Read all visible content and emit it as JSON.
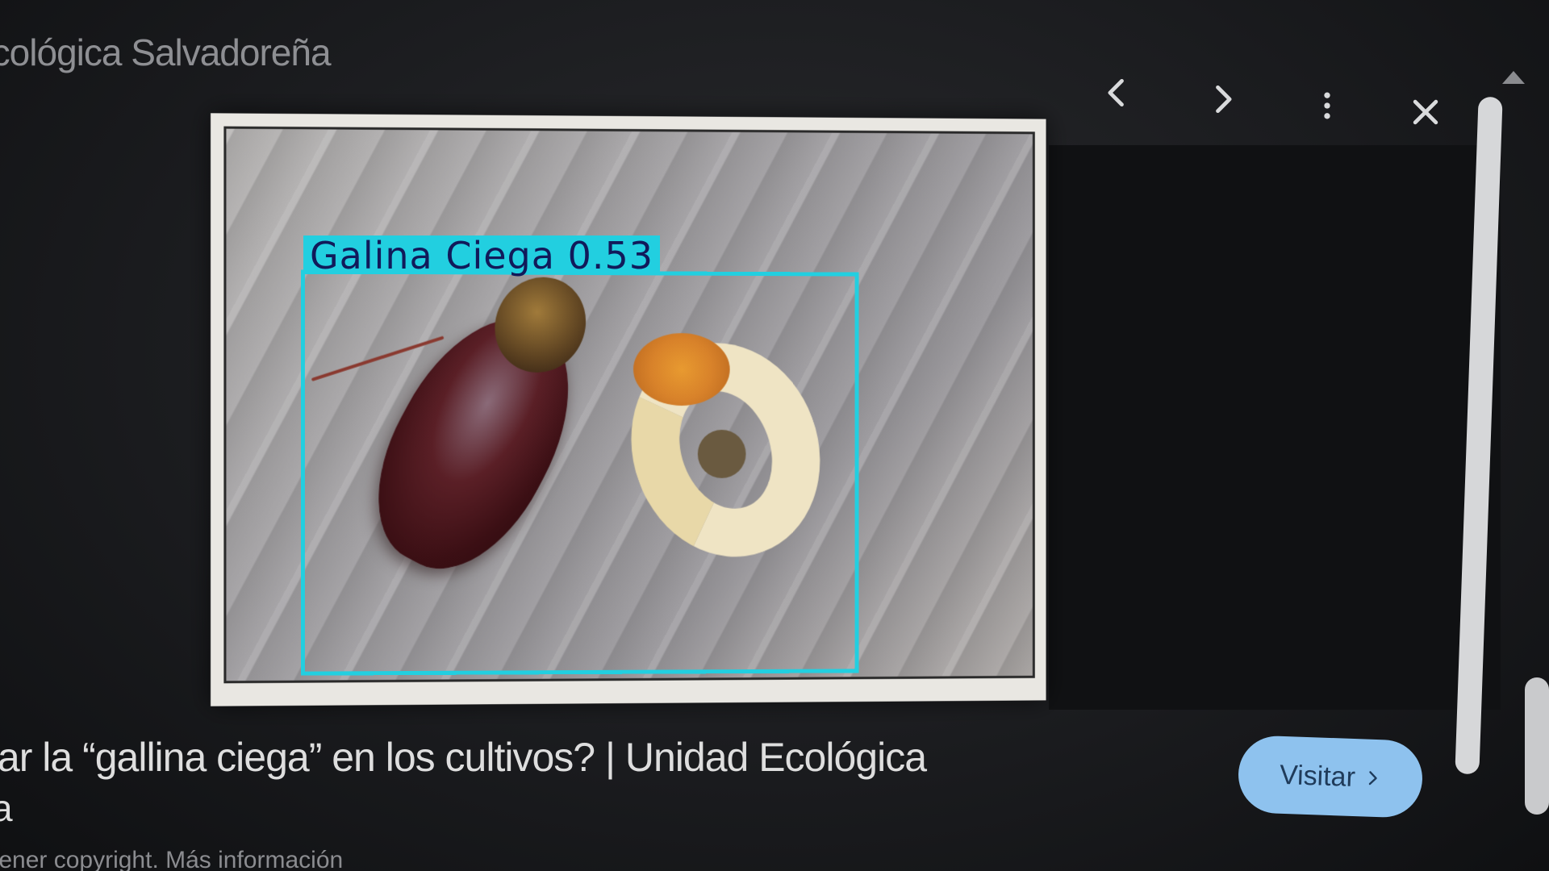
{
  "header": {
    "source_name": "Ecológica Salvadoreña"
  },
  "viewer_controls": {
    "prev_icon": "chevron-left-icon",
    "next_icon": "chevron-right-icon",
    "more_icon": "more-vert-icon",
    "close_icon": "close-icon"
  },
  "image": {
    "detection_label": "Galina  Ciega  0.53",
    "detection_color": "#22cfe0"
  },
  "details": {
    "title": "olar la “gallina ciega” en los cultivos? | Unidad Ecológica",
    "title_continued": "a",
    "copyright_text": "tener copyright. Más información",
    "visit_label": "Visitar",
    "visit_icon": "chevron-right-icon",
    "visit_color": "#8ec2ee"
  }
}
